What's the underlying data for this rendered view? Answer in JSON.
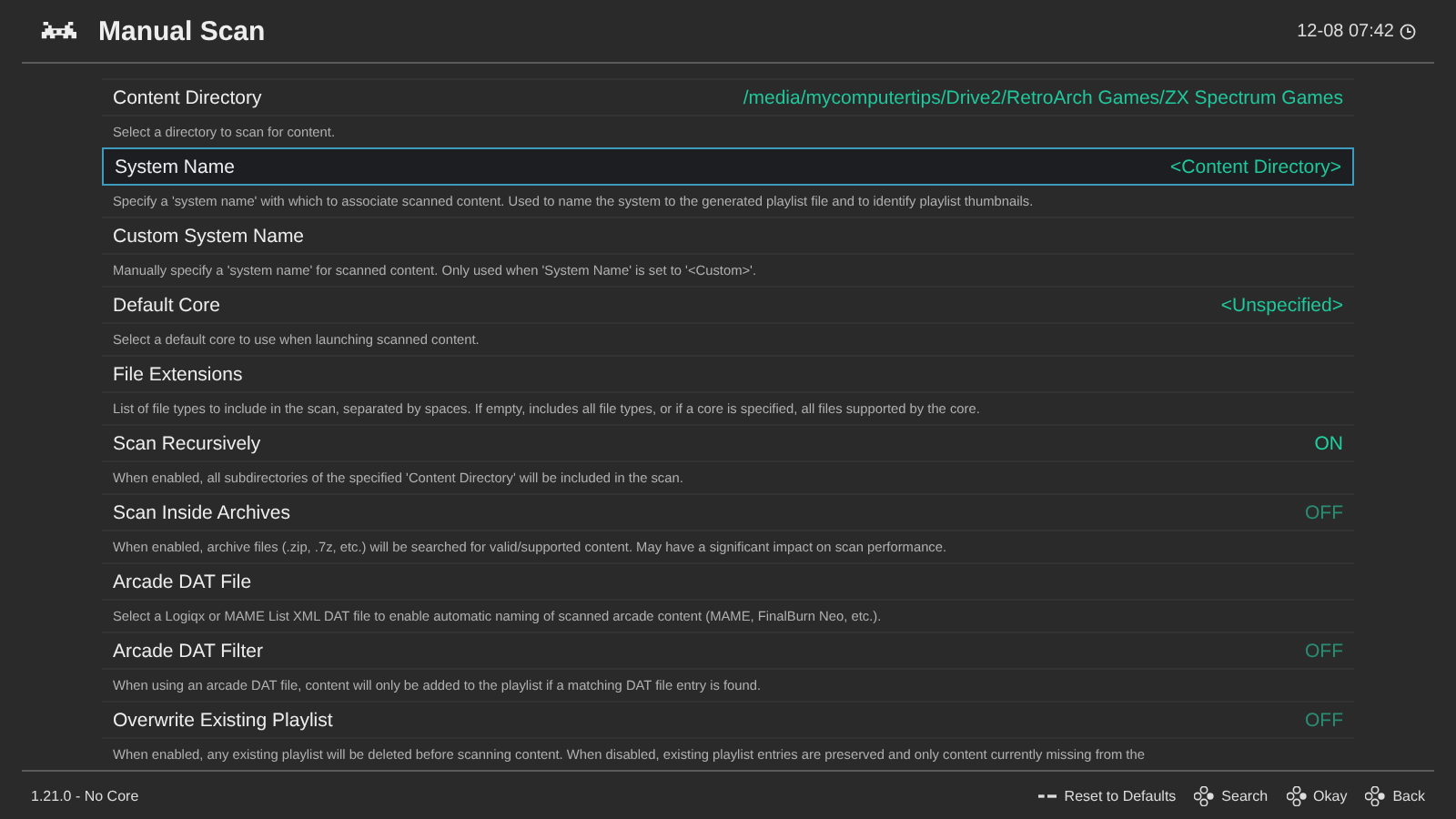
{
  "header": {
    "title": "Manual Scan",
    "clock": "12-08 07:42"
  },
  "items": [
    {
      "label": "Content Directory",
      "kind": "text",
      "value": "/media/mycomputertips/Drive2/RetroArch Games/ZX Spectrum Games",
      "selected": false,
      "description": "Select a directory to scan for content."
    },
    {
      "label": "System Name",
      "kind": "text",
      "value": "<Content Directory>",
      "selected": true,
      "description": "Specify a 'system name' with which to associate scanned content. Used to name the system to the generated playlist file and to identify playlist thumbnails."
    },
    {
      "label": "Custom System Name",
      "kind": "none",
      "selected": false,
      "description": "Manually specify a 'system name' for scanned content. Only used when 'System Name' is set to '<Custom>'."
    },
    {
      "label": "Default Core",
      "kind": "text",
      "value": "<Unspecified>",
      "selected": false,
      "description": "Select a default core to use when launching scanned content."
    },
    {
      "label": "File Extensions",
      "kind": "none",
      "selected": false,
      "description": "List of file types to include in the scan, separated by spaces. If empty, includes all file types, or if a core is specified, all files supported by the core."
    },
    {
      "label": "Scan Recursively",
      "kind": "toggle",
      "value": "ON",
      "on": true,
      "selected": false,
      "description": "When enabled, all subdirectories of the specified 'Content Directory' will be included in the scan."
    },
    {
      "label": "Scan Inside Archives",
      "kind": "toggle",
      "value": "OFF",
      "on": false,
      "selected": false,
      "description": "When enabled, archive files (.zip, .7z, etc.) will be searched for valid/supported content. May have a significant impact on scan performance."
    },
    {
      "label": "Arcade DAT File",
      "kind": "none",
      "selected": false,
      "description": "Select a Logiqx or MAME List XML DAT file to enable automatic naming of scanned arcade content (MAME, FinalBurn Neo, etc.)."
    },
    {
      "label": "Arcade DAT Filter",
      "kind": "toggle",
      "value": "OFF",
      "on": false,
      "selected": false,
      "description": "When using an arcade DAT file, content will only be added to the playlist if a matching DAT file entry is found."
    },
    {
      "label": "Overwrite Existing Playlist",
      "kind": "toggle",
      "value": "OFF",
      "on": false,
      "selected": false,
      "description": "When enabled, any existing playlist will be deleted before scanning content. When disabled, existing playlist entries are preserved and only content currently missing from the"
    }
  ],
  "footer": {
    "version": "1.21.0 - No Core",
    "actions": [
      {
        "label": "Reset to Defaults",
        "kind": "select"
      },
      {
        "label": "Search",
        "kind": "pad"
      },
      {
        "label": "Okay",
        "kind": "pad"
      },
      {
        "label": "Back",
        "kind": "pad"
      }
    ]
  }
}
